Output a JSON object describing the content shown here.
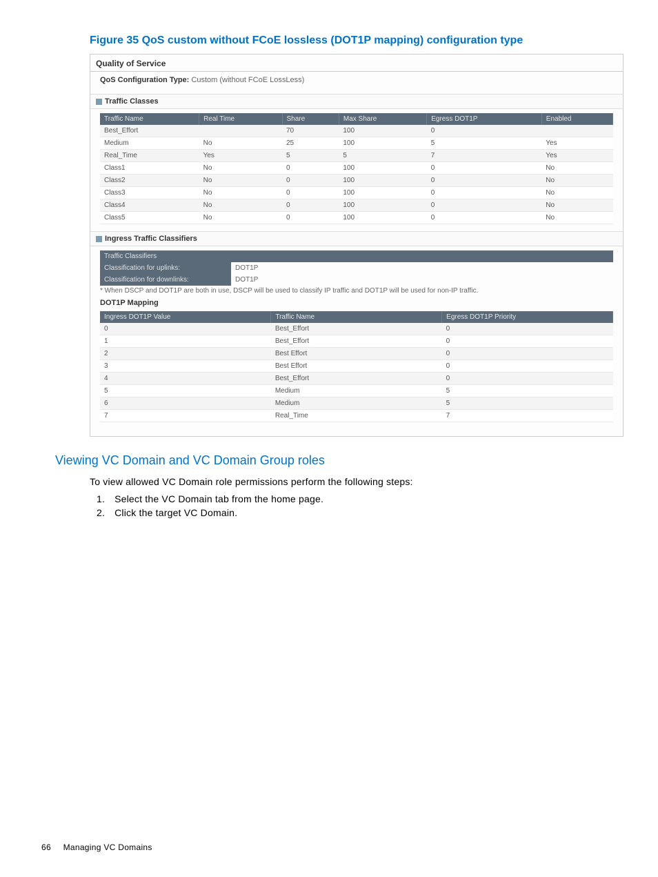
{
  "figure_title": "Figure 35 QoS custom without FCoE lossless (DOT1P mapping) configuration type",
  "qos": {
    "panel_title": "Quality of Service",
    "conf_label": "QoS Configuration Type:",
    "conf_value": "Custom (without FCoE LossLess)"
  },
  "traffic_classes": {
    "section_title": "Traffic Classes",
    "headers": [
      "Traffic Name",
      "Real Time",
      "Share",
      "Max Share",
      "Egress DOT1P",
      "Enabled"
    ],
    "rows": [
      [
        "Best_Effort",
        "",
        "70",
        "100",
        "0",
        ""
      ],
      [
        "Medium",
        "No",
        "25",
        "100",
        "5",
        "Yes"
      ],
      [
        "Real_Time",
        "Yes",
        "5",
        "5",
        "7",
        "Yes"
      ],
      [
        "Class1",
        "No",
        "0",
        "100",
        "0",
        "No"
      ],
      [
        "Class2",
        "No",
        "0",
        "100",
        "0",
        "No"
      ],
      [
        "Class3",
        "No",
        "0",
        "100",
        "0",
        "No"
      ],
      [
        "Class4",
        "No",
        "0",
        "100",
        "0",
        "No"
      ],
      [
        "Class5",
        "No",
        "0",
        "100",
        "0",
        "No"
      ]
    ]
  },
  "ingress": {
    "section_title": "Ingress Traffic Classifiers",
    "classifiers_label": "Traffic Classifiers",
    "uplinks_label": "Classification for uplinks:",
    "uplinks_value": "DOT1P",
    "downlinks_label": "Classification for downlinks:",
    "downlinks_value": "DOT1P",
    "note": "* When DSCP and DOT1P are both in use, DSCP will be used to classify IP traffic and DOT1P will be used for non-IP traffic.",
    "mapping_title": "DOT1P Mapping",
    "mapping_headers": [
      "Ingress DOT1P Value",
      "Traffic Name",
      "Egress DOT1P Priority"
    ],
    "mapping_rows": [
      [
        "0",
        "Best_Effort",
        "0"
      ],
      [
        "1",
        "Best_Effort",
        "0"
      ],
      [
        "2",
        "Best Effort",
        "0"
      ],
      [
        "3",
        "Best Effort",
        "0"
      ],
      [
        "4",
        "Best_Effort",
        "0"
      ],
      [
        "5",
        "Medium",
        "5"
      ],
      [
        "6",
        "Medium",
        "5"
      ],
      [
        "7",
        "Real_Time",
        "7"
      ]
    ]
  },
  "section_heading": "Viewing VC Domain and VC Domain Group roles",
  "intro_text": "To view allowed VC Domain role permissions perform the following steps:",
  "steps": [
    "Select the VC Domain tab from the home page.",
    "Click the target VC Domain."
  ],
  "footer": {
    "page": "66",
    "chapter": "Managing VC Domains"
  },
  "chart_data": {
    "type": "table",
    "title": "Traffic Classes",
    "columns": [
      "Traffic Name",
      "Real Time",
      "Share",
      "Max Share",
      "Egress DOT1P",
      "Enabled"
    ],
    "rows": [
      [
        "Best_Effort",
        "",
        70,
        100,
        0,
        ""
      ],
      [
        "Medium",
        "No",
        25,
        100,
        5,
        "Yes"
      ],
      [
        "Real_Time",
        "Yes",
        5,
        5,
        7,
        "Yes"
      ],
      [
        "Class1",
        "No",
        0,
        100,
        0,
        "No"
      ],
      [
        "Class2",
        "No",
        0,
        100,
        0,
        "No"
      ],
      [
        "Class3",
        "No",
        0,
        100,
        0,
        "No"
      ],
      [
        "Class4",
        "No",
        0,
        100,
        0,
        "No"
      ],
      [
        "Class5",
        "No",
        0,
        100,
        0,
        "No"
      ]
    ]
  }
}
